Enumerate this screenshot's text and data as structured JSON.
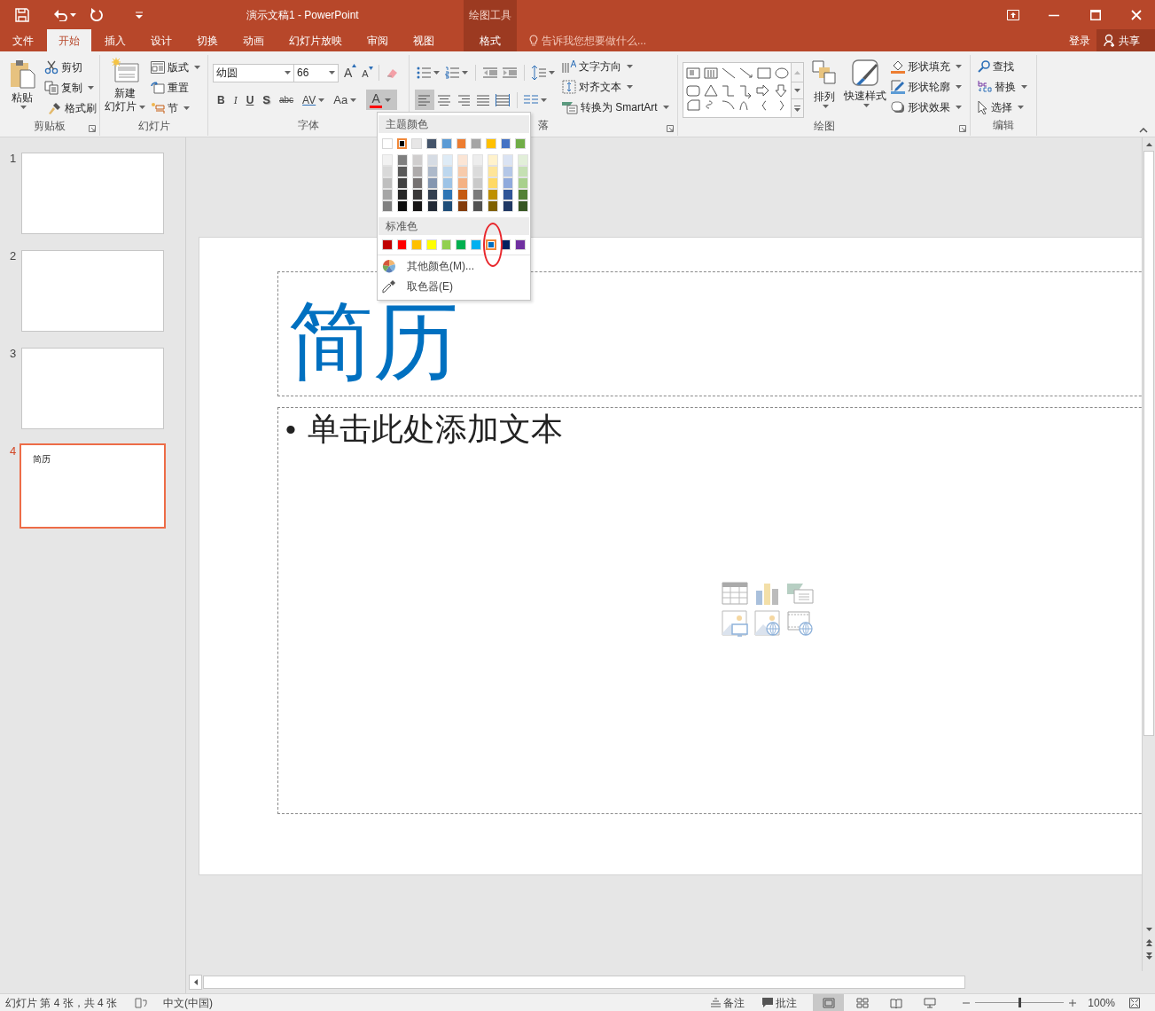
{
  "title_bar": {
    "title": "演示文稿1 - PowerPoint",
    "tool_group": "绘图工具",
    "sign_in": "登录",
    "share": "共享"
  },
  "tabs": [
    {
      "label": "文件",
      "selected": false,
      "contextual": false
    },
    {
      "label": "开始",
      "selected": true,
      "contextual": false
    },
    {
      "label": "插入",
      "selected": false,
      "contextual": false
    },
    {
      "label": "设计",
      "selected": false,
      "contextual": false
    },
    {
      "label": "切换",
      "selected": false,
      "contextual": false
    },
    {
      "label": "动画",
      "selected": false,
      "contextual": false
    },
    {
      "label": "幻灯片放映",
      "selected": false,
      "contextual": false
    },
    {
      "label": "审阅",
      "selected": false,
      "contextual": false
    },
    {
      "label": "视图",
      "selected": false,
      "contextual": false
    },
    {
      "label": "格式",
      "selected": false,
      "contextual": true
    }
  ],
  "tell_me": {
    "placeholder": "告诉我您想要做什么..."
  },
  "ribbon": {
    "clipboard": {
      "label": "剪贴板",
      "paste": "粘贴",
      "items": [
        "剪切",
        "复制",
        "格式刷"
      ]
    },
    "slides": {
      "label": "幻灯片",
      "new_slide": [
        "新建",
        "幻灯片"
      ],
      "items": [
        "版式",
        "重置",
        "节"
      ]
    },
    "font": {
      "label": "字体",
      "font_name": "幼圆",
      "font_size": "66",
      "size_buttons": [
        {
          "kind": "grow",
          "glyph": "A"
        },
        {
          "kind": "shrink",
          "glyph": "A"
        }
      ],
      "styles": [
        {
          "kind": "bold",
          "glyph": "B"
        },
        {
          "kind": "italic",
          "glyph": "I"
        },
        {
          "kind": "underline",
          "glyph": "U"
        },
        {
          "kind": "shadow",
          "glyph": "S"
        },
        {
          "kind": "strike",
          "glyph": "abc"
        },
        {
          "kind": "spacing",
          "glyph": "AV"
        },
        {
          "kind": "case",
          "glyph": "Aa"
        }
      ],
      "font_color": {
        "glyph": "A",
        "color": "#ff0000",
        "open": true
      }
    },
    "paragraph": {
      "label": "落",
      "alignment": [
        {
          "kind": "left",
          "selected": true
        },
        {
          "kind": "center",
          "selected": false
        },
        {
          "kind": "right",
          "selected": false
        },
        {
          "kind": "justify",
          "selected": false
        },
        {
          "kind": "distributed",
          "selected": false
        }
      ],
      "items": [
        "文字方向",
        "对齐文本",
        "转换为 SmartArt"
      ]
    },
    "drawing": {
      "label": "绘图",
      "arrange": "排列",
      "quick_styles": "快速样式",
      "items": [
        "形状填充",
        "形状轮廓",
        "形状效果"
      ]
    },
    "editing": {
      "label": "编辑",
      "items": [
        "查找",
        "替换",
        "选择"
      ]
    }
  },
  "color_menu": {
    "theme_label": "主题颜色",
    "theme_colors": [
      {
        "color": "#ffffff",
        "selected": false,
        "shades": [
          {
            "color": "#f2f2f2"
          },
          {
            "color": "#d9d9d9"
          },
          {
            "color": "#bfbfbf"
          },
          {
            "color": "#a6a6a6"
          },
          {
            "color": "#808080"
          }
        ]
      },
      {
        "color": "#000000",
        "selected": true,
        "shades": [
          {
            "color": "#7f7f7f"
          },
          {
            "color": "#595959"
          },
          {
            "color": "#404040"
          },
          {
            "color": "#262626"
          },
          {
            "color": "#0d0d0d"
          }
        ]
      },
      {
        "color": "#e7e6e6",
        "selected": false,
        "shades": [
          {
            "color": "#d0cece"
          },
          {
            "color": "#aeabab"
          },
          {
            "color": "#757171"
          },
          {
            "color": "#3a3838"
          },
          {
            "color": "#171616"
          }
        ]
      },
      {
        "color": "#44546a",
        "selected": false,
        "shades": [
          {
            "color": "#d6dce4"
          },
          {
            "color": "#adb9ca"
          },
          {
            "color": "#8496b0"
          },
          {
            "color": "#333f4f"
          },
          {
            "color": "#222a35"
          }
        ]
      },
      {
        "color": "#5b9bd5",
        "selected": false,
        "shades": [
          {
            "color": "#deebf6"
          },
          {
            "color": "#bdd7ee"
          },
          {
            "color": "#9dc3e6"
          },
          {
            "color": "#2e75b5"
          },
          {
            "color": "#1f4e79"
          }
        ]
      },
      {
        "color": "#ed7d31",
        "selected": false,
        "shades": [
          {
            "color": "#fbe5d5"
          },
          {
            "color": "#f7cbac"
          },
          {
            "color": "#f4b183"
          },
          {
            "color": "#c55a11"
          },
          {
            "color": "#833c0b"
          }
        ]
      },
      {
        "color": "#a5a5a5",
        "selected": false,
        "shades": [
          {
            "color": "#ededed"
          },
          {
            "color": "#dbdbdb"
          },
          {
            "color": "#c9c9c9"
          },
          {
            "color": "#7b7b7b"
          },
          {
            "color": "#525252"
          }
        ]
      },
      {
        "color": "#ffc000",
        "selected": false,
        "shades": [
          {
            "color": "#fff2cc"
          },
          {
            "color": "#fee599"
          },
          {
            "color": "#ffd965"
          },
          {
            "color": "#bf9000"
          },
          {
            "color": "#7f6000"
          }
        ]
      },
      {
        "color": "#4472c4",
        "selected": false,
        "shades": [
          {
            "color": "#dae3f3"
          },
          {
            "color": "#b4c7e7"
          },
          {
            "color": "#8faadc"
          },
          {
            "color": "#2f5597"
          },
          {
            "color": "#203864"
          }
        ]
      },
      {
        "color": "#70ad47",
        "selected": false,
        "shades": [
          {
            "color": "#e2efd9"
          },
          {
            "color": "#c5e0b3"
          },
          {
            "color": "#a8d08d"
          },
          {
            "color": "#538135"
          },
          {
            "color": "#375623"
          }
        ]
      }
    ],
    "standard_label": "标准色",
    "standard_colors": [
      {
        "color": "#c00000",
        "selected": false,
        "circled": false
      },
      {
        "color": "#ff0000",
        "selected": false,
        "circled": false
      },
      {
        "color": "#ffc000",
        "selected": false,
        "circled": false
      },
      {
        "color": "#ffff00",
        "selected": false,
        "circled": false
      },
      {
        "color": "#92d050",
        "selected": false,
        "circled": false
      },
      {
        "color": "#00b050",
        "selected": false,
        "circled": false
      },
      {
        "color": "#00b0f0",
        "selected": false,
        "circled": false
      },
      {
        "color": "#0070c0",
        "selected": true,
        "circled": true
      },
      {
        "color": "#002060",
        "selected": false,
        "circled": false
      },
      {
        "color": "#7030a0",
        "selected": false,
        "circled": false
      }
    ],
    "more_colors": "其他颜色(M)...",
    "eyedropper": "取色器(E)"
  },
  "slides_panel": [
    {
      "number": "1",
      "selected": false
    },
    {
      "number": "2",
      "selected": false
    },
    {
      "number": "3",
      "selected": false
    },
    {
      "number": "4",
      "selected": true,
      "text": "简历"
    }
  ],
  "slide": {
    "title": "简历",
    "bullet": "•",
    "body": "单击此处添加文本"
  },
  "status_bar": {
    "slide_info": "幻灯片 第 4 张，共 4 张",
    "language": "中文(中国)",
    "notes": "备注",
    "comments": "批注",
    "views": [
      {
        "kind": "normal",
        "selected": true
      },
      {
        "kind": "sorter",
        "selected": false
      },
      {
        "kind": "reading",
        "selected": false
      },
      {
        "kind": "show",
        "selected": false
      }
    ],
    "zoom_slider": {
      "level": 0.5
    },
    "zoom": "100%"
  }
}
